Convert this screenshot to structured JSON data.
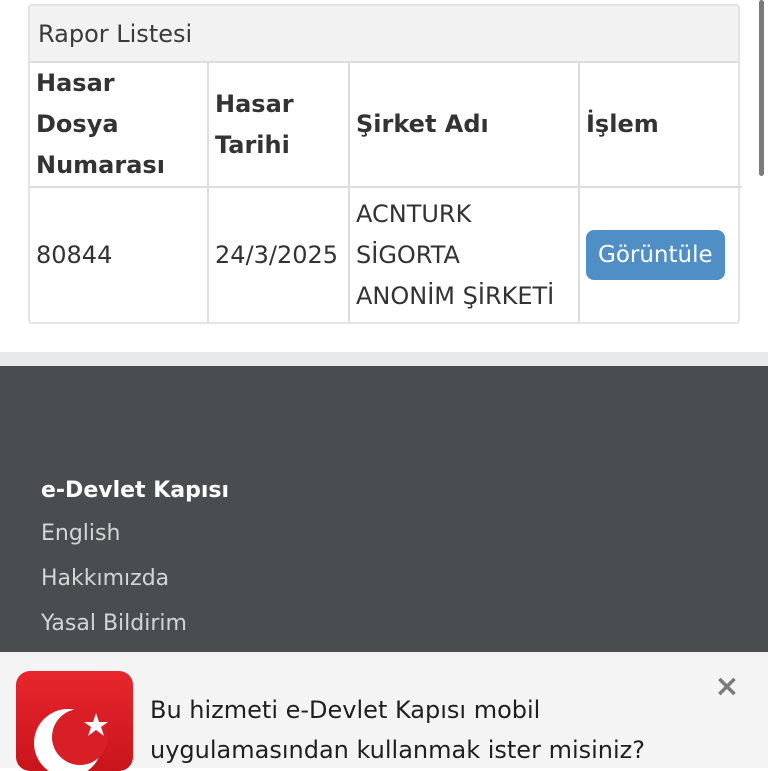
{
  "report_panel": {
    "title": "Rapor Listesi",
    "columns": [
      [
        "Hasar Dosya",
        "Numarası"
      ],
      [
        "Hasar",
        "Tarihi"
      ],
      [
        "Şirket Adı"
      ],
      [
        "İşlem"
      ]
    ],
    "rows": [
      {
        "file_number": "80844",
        "date": "24/3/2025",
        "company_lines": [
          "ACNTURK",
          "SİGORTA",
          "ANONİM ŞİRKETİ"
        ],
        "action_label": "Görüntüle"
      }
    ]
  },
  "footer": {
    "title": "e-Devlet Kapısı",
    "links": [
      "English",
      "Hakkımızda",
      "Yasal Bildirim"
    ]
  },
  "app_banner": {
    "icon": "e-devlet-crescent-star-icon",
    "text_lines": [
      "Bu hizmeti e-Devlet Kapısı mobil",
      "uygulamasından kullanmak ister misiniz?"
    ],
    "close_icon": "close-icon"
  },
  "colors": {
    "button": "#4f8fc5",
    "footer_bg": "#4a4d4f",
    "icon_red": "#d91c24"
  }
}
